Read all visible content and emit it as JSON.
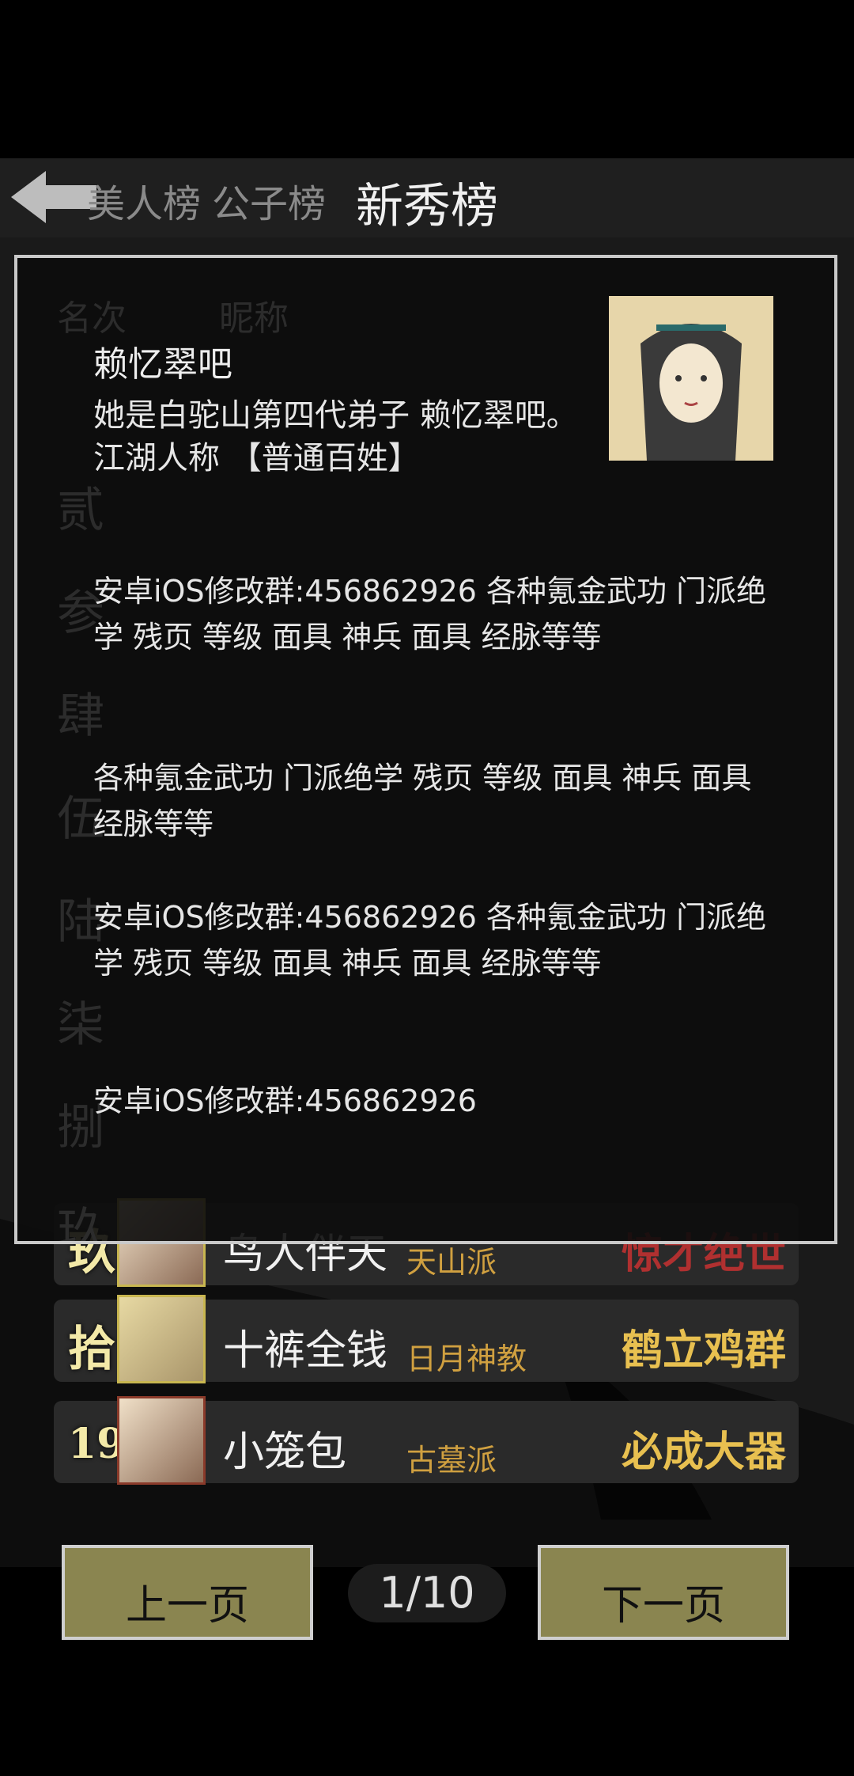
{
  "tabs": {
    "tab1": "美人榜",
    "tab2": "公子榜",
    "tab3": "新秀榜"
  },
  "ghost": {
    "col_rank": "名次",
    "col_name": "昵称",
    "rows": [
      "贰",
      "参",
      "肆",
      "伍",
      "陆",
      "柒",
      "捌",
      "玖"
    ]
  },
  "ranking": [
    {
      "rank": "玖",
      "name": "鸟人伴天",
      "school": "天山派",
      "title": "惊才绝世"
    },
    {
      "rank": "拾",
      "name": "十裤全钱",
      "school": "日月神教",
      "title": "鹤立鸡群"
    },
    {
      "rank": "19",
      "name": "小笼包",
      "school": "古墓派",
      "title": "必成大器"
    }
  ],
  "popup": {
    "player_name": "赖忆翠吧",
    "description_line1": "她是白驼山第四代弟子 赖忆翠吧。",
    "description_line2": "江湖人称 【普通百姓】",
    "messages": [
      "安卓iOS修改群:456862926 各种氪金武功 门派绝学 残页 等级 面具 神兵 面具 经脉等等",
      "各种氪金武功 门派绝学 残页 等级 面具 神兵 面具 经脉等等",
      "安卓iOS修改群:456862926 各种氪金武功 门派绝学 残页 等级 面具 神兵 面具 经脉等等",
      "安卓iOS修改群:456862926"
    ]
  },
  "pagination": {
    "prev": "上一页",
    "page": "1/10",
    "next": "下一页"
  }
}
